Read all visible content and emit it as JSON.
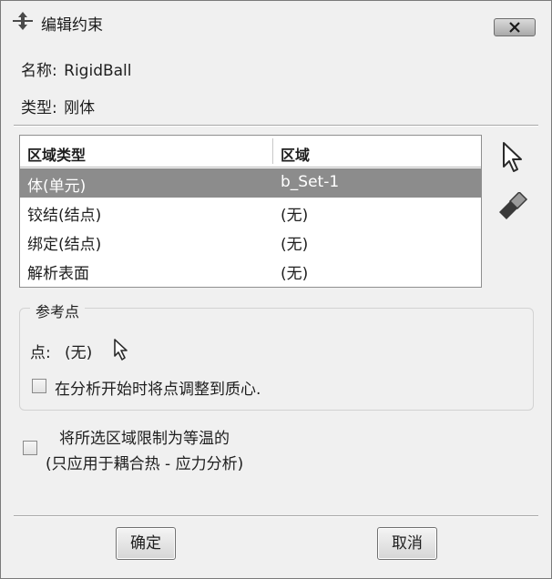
{
  "window": {
    "title": "编辑约束",
    "title_icon": "constraint-arrows-icon",
    "close_icon": "close-icon"
  },
  "info": {
    "name_label": "名称:",
    "name_value": "RigidBall",
    "type_label": "类型:",
    "type_value": "刚体"
  },
  "region_table": {
    "headers": [
      "区域类型",
      "区域"
    ],
    "rows": [
      {
        "type": "体(单元)",
        "region": "b_Set-1",
        "selected": true
      },
      {
        "type": "铰结(结点)",
        "region": "(无)",
        "selected": false
      },
      {
        "type": "绑定(结点)",
        "region": "(无)",
        "selected": false
      },
      {
        "type": "解析表面",
        "region": "(无)",
        "selected": false
      }
    ]
  },
  "side_tools": {
    "select_icon": "pointer-arrow-icon",
    "erase_icon": "eraser-icon"
  },
  "reference_point": {
    "group_title": "参考点",
    "point_label": "点:",
    "point_value": "(无)",
    "pick_icon": "pointer-arrow-icon",
    "adjust_checkbox_label": "在分析开始时将点调整到质心.",
    "adjust_checked": false
  },
  "isothermal": {
    "line1": "将所选区域限制为等温的",
    "line2": "(只应用于耦合热 - 应力分析)",
    "checked": false
  },
  "buttons": {
    "ok": "确定",
    "cancel": "取消"
  },
  "colors": {
    "selected_row": "#8c8c8c",
    "dialog_bg": "#f0f0f0"
  }
}
